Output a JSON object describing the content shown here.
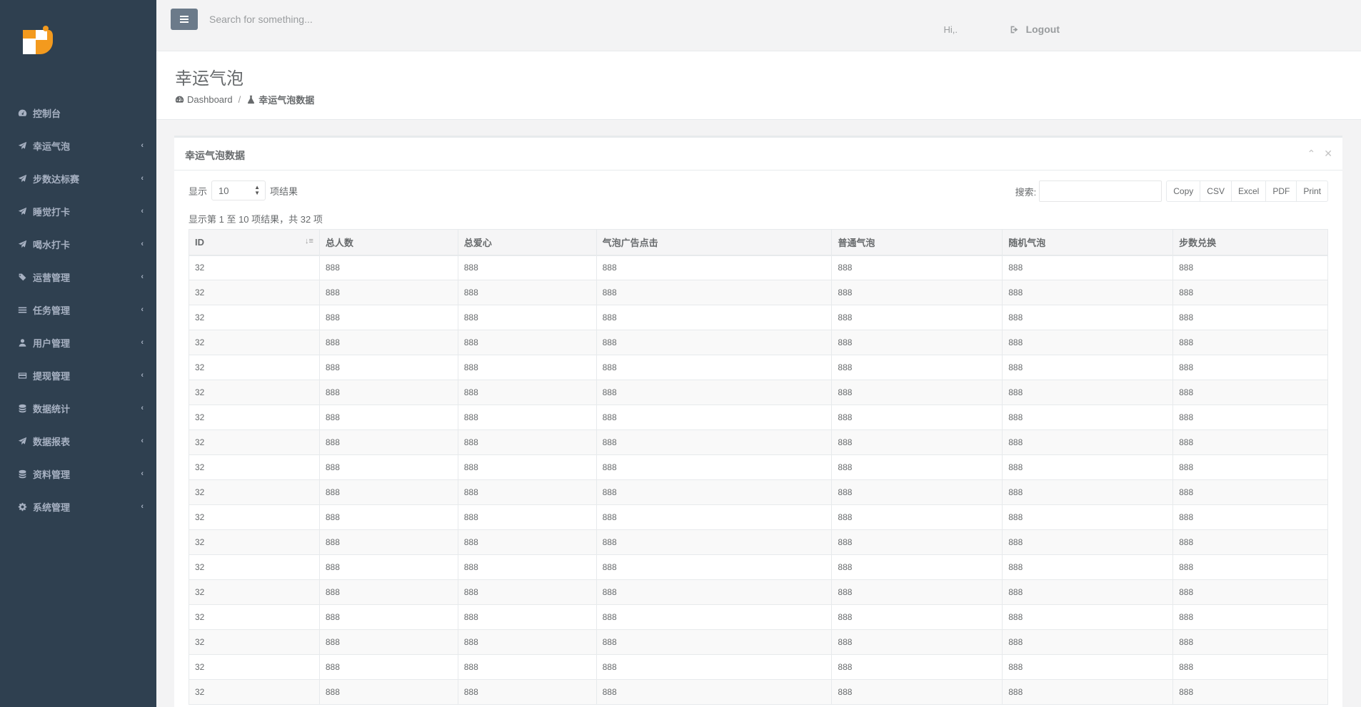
{
  "topbar": {
    "search_placeholder": "Search for something...",
    "greeting": "Hi,.",
    "logout_label": "Logout"
  },
  "sidebar": {
    "items": [
      {
        "label": "控制台",
        "icon": "dashboard-icon",
        "has_submenu": false
      },
      {
        "label": "幸运气泡",
        "icon": "paper-plane-icon",
        "has_submenu": true
      },
      {
        "label": "步数达标赛",
        "icon": "paper-plane-icon",
        "has_submenu": true
      },
      {
        "label": "睡觉打卡",
        "icon": "paper-plane-icon",
        "has_submenu": true
      },
      {
        "label": "喝水打卡",
        "icon": "paper-plane-icon",
        "has_submenu": true
      },
      {
        "label": "运营管理",
        "icon": "tags-icon",
        "has_submenu": true
      },
      {
        "label": "任务管理",
        "icon": "list-icon",
        "has_submenu": true
      },
      {
        "label": "用户管理",
        "icon": "user-icon",
        "has_submenu": true
      },
      {
        "label": "提现管理",
        "icon": "credit-card-icon",
        "has_submenu": true
      },
      {
        "label": "数据统计",
        "icon": "database-icon",
        "has_submenu": true
      },
      {
        "label": "数据报表",
        "icon": "paper-plane-icon",
        "has_submenu": true
      },
      {
        "label": "资料管理",
        "icon": "database-icon",
        "has_submenu": true
      },
      {
        "label": "系统管理",
        "icon": "gear-icon",
        "has_submenu": true
      }
    ]
  },
  "heading": {
    "title": "幸运气泡",
    "breadcrumb_home": "Dashboard",
    "breadcrumb_current": "幸运气泡数据"
  },
  "panel": {
    "title": "幸运气泡数据",
    "length_prefix": "显示",
    "length_value": "10",
    "length_suffix": "项结果",
    "search_label": "搜索:",
    "buttons": [
      "Copy",
      "CSV",
      "Excel",
      "PDF",
      "Print"
    ],
    "info": "显示第 1 至 10 项结果，共 32 项"
  },
  "table": {
    "columns": [
      "ID",
      "总人数",
      "总爱心",
      "气泡广告点击",
      "普通气泡",
      "随机气泡",
      "步数兑换"
    ],
    "rows": [
      [
        "32",
        "888",
        "888",
        "888",
        "888",
        "888",
        "888"
      ],
      [
        "32",
        "888",
        "888",
        "888",
        "888",
        "888",
        "888"
      ],
      [
        "32",
        "888",
        "888",
        "888",
        "888",
        "888",
        "888"
      ],
      [
        "32",
        "888",
        "888",
        "888",
        "888",
        "888",
        "888"
      ],
      [
        "32",
        "888",
        "888",
        "888",
        "888",
        "888",
        "888"
      ],
      [
        "32",
        "888",
        "888",
        "888",
        "888",
        "888",
        "888"
      ],
      [
        "32",
        "888",
        "888",
        "888",
        "888",
        "888",
        "888"
      ],
      [
        "32",
        "888",
        "888",
        "888",
        "888",
        "888",
        "888"
      ],
      [
        "32",
        "888",
        "888",
        "888",
        "888",
        "888",
        "888"
      ],
      [
        "32",
        "888",
        "888",
        "888",
        "888",
        "888",
        "888"
      ],
      [
        "32",
        "888",
        "888",
        "888",
        "888",
        "888",
        "888"
      ],
      [
        "32",
        "888",
        "888",
        "888",
        "888",
        "888",
        "888"
      ],
      [
        "32",
        "888",
        "888",
        "888",
        "888",
        "888",
        "888"
      ],
      [
        "32",
        "888",
        "888",
        "888",
        "888",
        "888",
        "888"
      ],
      [
        "32",
        "888",
        "888",
        "888",
        "888",
        "888",
        "888"
      ],
      [
        "32",
        "888",
        "888",
        "888",
        "888",
        "888",
        "888"
      ],
      [
        "32",
        "888",
        "888",
        "888",
        "888",
        "888",
        "888"
      ],
      [
        "32",
        "888",
        "888",
        "888",
        "888",
        "888",
        "888"
      ]
    ]
  },
  "colors": {
    "sidebar_bg": "#2f4050",
    "sidebar_text": "#a7b1c2",
    "logo_orange": "#f39a1e"
  }
}
